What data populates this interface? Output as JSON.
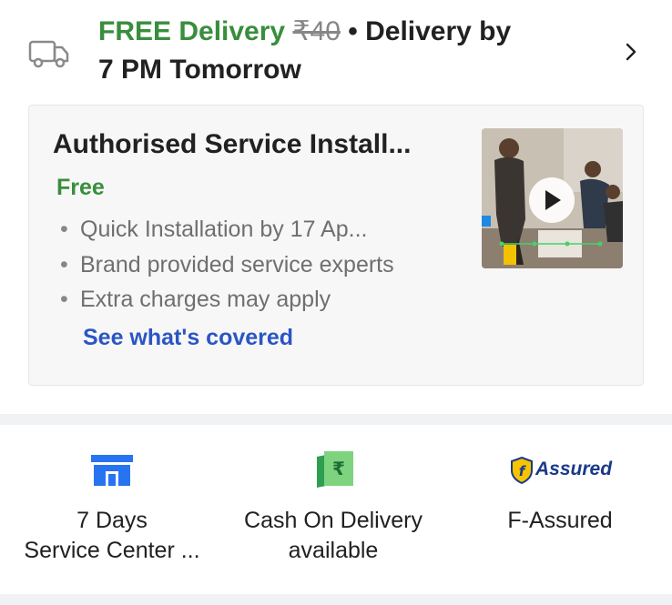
{
  "delivery": {
    "free_label": "FREE Delivery",
    "original_price": "₹40",
    "separator": " • ",
    "delivery_by": "Delivery by",
    "delivery_time": "7 PM Tomorrow",
    "icon": "truck-icon",
    "chevron": "chevron-right-icon"
  },
  "installation": {
    "title": "Authorised Service Install...",
    "price_label": "Free",
    "bullets": [
      "Quick Installation by 17 Ap...",
      "Brand provided service experts",
      "Extra charges may apply"
    ],
    "link": "See what's covered",
    "video_icon": "play-icon"
  },
  "features": [
    {
      "icon": "store-icon",
      "label_line1": "7 Days",
      "label_line2": "Service Center ..."
    },
    {
      "icon": "rupee-note-icon",
      "label_line1": "Cash On Delivery",
      "label_line2": "available"
    },
    {
      "icon": "assured-icon",
      "badge_text": "Assured",
      "label_line1": "F-Assured",
      "label_line2": ""
    }
  ],
  "colors": {
    "green": "#388e3c",
    "link_blue": "#2a55c5",
    "icon_blue": "#2874f0",
    "note_green": "#4caf50"
  }
}
